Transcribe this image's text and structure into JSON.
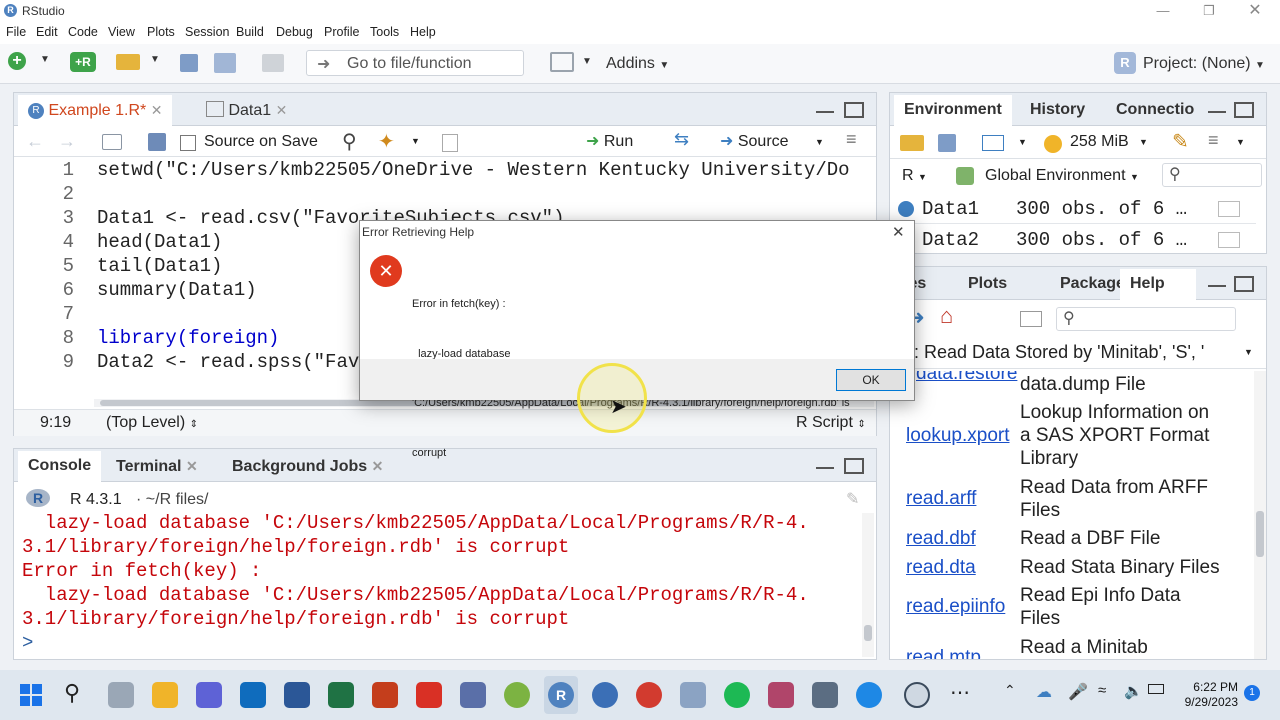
{
  "window": {
    "title": "RStudio",
    "icon": "R"
  },
  "menu": [
    "File",
    "Edit",
    "Code",
    "View",
    "Plots",
    "Session",
    "Build",
    "Debug",
    "Profile",
    "Tools",
    "Help"
  ],
  "toolbar": {
    "goto_placeholder": "Go to file/function",
    "addins": "Addins",
    "project": "Project: (None)"
  },
  "editor": {
    "tabs": [
      {
        "label": "Example 1.R*"
      },
      {
        "label": "Data1"
      }
    ],
    "source_on_save": "Source on Save",
    "run": "Run",
    "source": "Source",
    "lines": [
      {
        "n": "1",
        "text": "setwd(\"C:/Users/kmb22505/OneDrive - Western Kentucky University/Do"
      },
      {
        "n": "2",
        "text": ""
      },
      {
        "n": "3",
        "text": "Data1 <- read.csv(\"FavoriteSubjects.csv\")"
      },
      {
        "n": "4",
        "text": "head(Data1)"
      },
      {
        "n": "5",
        "text": "tail(Data1)"
      },
      {
        "n": "6",
        "text": "summary(Data1)"
      },
      {
        "n": "7",
        "text": ""
      },
      {
        "n": "8",
        "text": "library(foreign)"
      },
      {
        "n": "9",
        "text": "Data2 <- read.spss(\"Fav"
      }
    ],
    "status_pos": "9:19",
    "status_scope": "(Top Level)",
    "status_type": "R Script"
  },
  "console": {
    "tabs": [
      {
        "label": "Console"
      },
      {
        "label": "Terminal"
      },
      {
        "label": "Background Jobs"
      }
    ],
    "version": "R 4.3.1",
    "path": "· ~/R files/",
    "lines": [
      "  lazy-load database 'C:/Users/kmb22505/AppData/Local/Programs/R/R-4.",
      "3.1/library/foreign/help/foreign.rdb' is corrupt",
      "Error in fetch(key) :",
      "  lazy-load database 'C:/Users/kmb22505/AppData/Local/Programs/R/R-4.",
      "3.1/library/foreign/help/foreign.rdb' is corrupt"
    ],
    "prompt": ">"
  },
  "environment": {
    "tabs": [
      {
        "label": "Environment"
      },
      {
        "label": "History"
      },
      {
        "label": "Connectio"
      }
    ],
    "memory": "258 MiB",
    "lang": "R",
    "scope": "Global Environment",
    "rows": [
      {
        "name": "Data1",
        "value": "300 obs. of 6 …"
      },
      {
        "name": "Data2",
        "value": "300 obs. of 6 …"
      }
    ]
  },
  "help": {
    "tabs": [
      {
        "label": "les"
      },
      {
        "label": "Plots"
      },
      {
        "label": "Packages"
      },
      {
        "label": "Help"
      }
    ],
    "topic": ": Read Data Stored by 'Minitab', 'S', '",
    "rows": [
      {
        "link": "data.restore",
        "desc": [
          "data.dump File"
        ]
      },
      {
        "link": "lookup.xport",
        "desc": [
          "Lookup Information on",
          "a SAS XPORT Format",
          "Library"
        ]
      },
      {
        "link": "read.arff",
        "desc": [
          "Read Data from ARFF",
          "Files"
        ]
      },
      {
        "link": "read.dbf",
        "desc": [
          "Read a DBF File"
        ]
      },
      {
        "link": "read.dta",
        "desc": [
          "Read Stata Binary Files"
        ]
      },
      {
        "link": "read.epiinfo",
        "desc": [
          "Read Epi Info Data",
          "Files"
        ]
      },
      {
        "link": "read.mtp",
        "desc": [
          "Read a Minitab"
        ]
      }
    ]
  },
  "dialog": {
    "title": "Error Retrieving Help",
    "lines": [
      "Error in fetch(key) :",
      "  lazy-load database",
      "'C:/Users/kmb22505/AppData/Local/Programs/R/R-4.3.1/library/foreign/help/foreign.rdb' is",
      "corrupt"
    ],
    "ok": "OK"
  },
  "taskbar": {
    "time": "6:22 PM",
    "date": "9/29/2023",
    "badge": "1"
  },
  "colors": {
    "accent": "#4f82bf",
    "error_red": "#c5060b",
    "dialog_icon": "#e03a1e"
  }
}
